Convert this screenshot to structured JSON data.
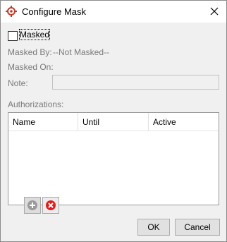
{
  "window": {
    "title": "Configure Mask"
  },
  "masked": {
    "label": "Masked",
    "checked": false
  },
  "fields": {
    "masked_by_label": "Masked By:",
    "masked_by_value": "--Not Masked--",
    "masked_on_label": "Masked On:",
    "masked_on_value": "",
    "note_label": "Note:",
    "note_value": ""
  },
  "authorizations": {
    "label": "Authorizations:",
    "columns": [
      "Name",
      "Until",
      "Active"
    ],
    "rows": []
  },
  "buttons": {
    "ok": "OK",
    "cancel": "Cancel"
  },
  "icons": {
    "app": "target-icon",
    "close": "close-icon",
    "add": "plus-circle-icon",
    "remove": "red-x-circle-icon"
  },
  "colors": {
    "app_icon": "#c0392b",
    "remove_icon": "#e31b1b",
    "add_icon": "#9a9a9a"
  }
}
